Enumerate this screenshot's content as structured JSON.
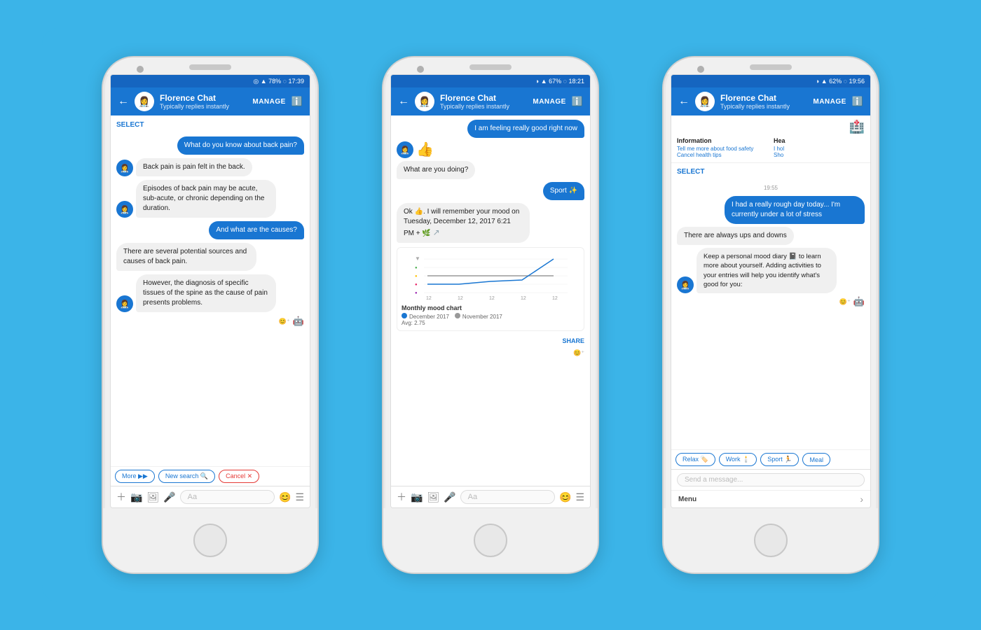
{
  "background": "#3BB4E8",
  "phones": [
    {
      "id": "phone1",
      "status_bar": {
        "icons": "◎ ▲ 78% ◌ 17:39"
      },
      "header": {
        "title": "Florence Chat",
        "subtitle": "Typically replies instantly",
        "manage": "MANAGE",
        "back": "←"
      },
      "select_label": "SELECT",
      "messages": [
        {
          "type": "sent",
          "text": "What do you know about back pain?"
        },
        {
          "type": "received",
          "text": "Back pain is pain felt in the back."
        },
        {
          "type": "received",
          "text": "Episodes of back pain may be acute, sub-acute, or chronic depending on the duration."
        },
        {
          "type": "sent",
          "text": "And what are the causes?"
        },
        {
          "type": "received",
          "text": "There are several potential sources and causes of back pain."
        },
        {
          "type": "received",
          "text": "However, the diagnosis of specific tissues of the spine as the cause of pain presents problems."
        }
      ],
      "quick_replies": [
        {
          "label": "More ▶▶"
        },
        {
          "label": "New search 🔍"
        },
        {
          "label": "Cancel ✕"
        }
      ],
      "input_placeholder": "Aa"
    },
    {
      "id": "phone2",
      "status_bar": {
        "icons": "◑ ▲ 67% ◌ 18:21"
      },
      "header": {
        "title": "Florence Chat",
        "subtitle": "Typically replies instantly",
        "manage": "MANAGE",
        "back": "←"
      },
      "messages": [
        {
          "type": "sent",
          "text": "I am feeling really good right now"
        },
        {
          "type": "emoji",
          "text": "👍"
        },
        {
          "type": "bot_label",
          "text": "What are you doing?"
        },
        {
          "type": "sent",
          "text": "Sport ✨"
        },
        {
          "type": "received",
          "text": "Ok 👍. I will remember your mood on Tuesday, December 12, 2017 6:21 PM + 🌿"
        }
      ],
      "chart": {
        "title": "Monthly mood chart",
        "legend": [
          {
            "label": "December 2017",
            "color": "#1976D2"
          },
          {
            "label": "November 2017",
            "color": "#999"
          }
        ],
        "avg": "Avg: 2.75",
        "x_labels": [
          "12",
          "12",
          "12",
          "12",
          "12"
        ]
      },
      "share_label": "SHARE",
      "input_placeholder": "Aa"
    },
    {
      "id": "phone3",
      "status_bar": {
        "icons": "◑ ▲ 62% ◌ 19:56"
      },
      "header": {
        "title": "Florence Chat",
        "subtitle": "Typically replies instantly",
        "manage": "MANAGE",
        "back": "←"
      },
      "info_panel": {
        "col1_title": "Information",
        "col1_items": [
          "Tell me more about food safety",
          "Cancel health tips"
        ],
        "col2_title": "Hea",
        "col2_items": [
          "I hol",
          "Sho"
        ]
      },
      "select_label": "SELECT",
      "timestamp": "19:55",
      "messages": [
        {
          "type": "sent",
          "text": "I had a really rough day today... I'm currently under a lot of stress"
        },
        {
          "type": "received_plain",
          "text": "There are always ups and downs"
        },
        {
          "type": "received",
          "text": "Keep a personal mood diary 📓 to learn more about yourself. Adding activities to your entries will help you identify what's good for you:"
        }
      ],
      "quick_replies": [
        {
          "label": "Relax 🏷️"
        },
        {
          "label": "Work 🕯️"
        },
        {
          "label": "Sport 🏃"
        },
        {
          "label": "Meal"
        }
      ],
      "input_placeholder": "Send a message...",
      "menu_label": "Menu",
      "menu_arrow": "›"
    }
  ]
}
